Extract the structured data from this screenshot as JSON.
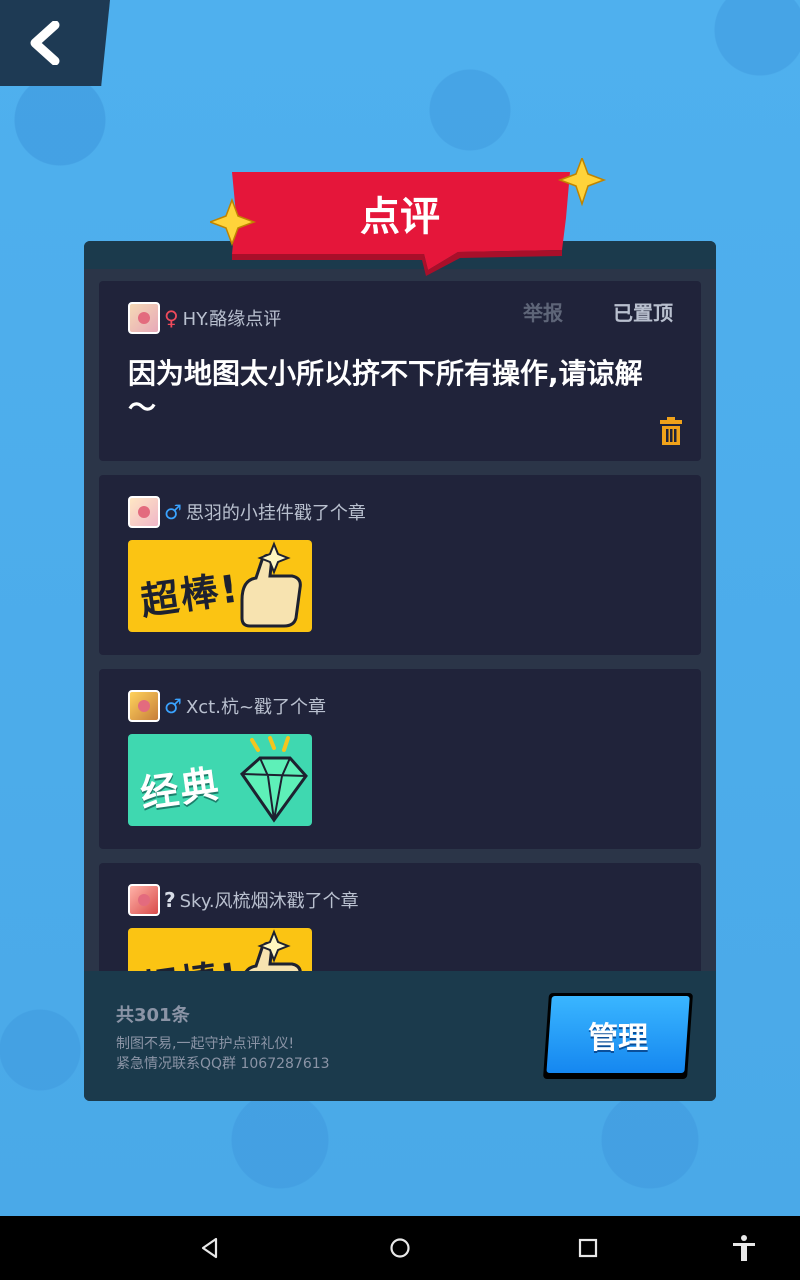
{
  "header": {
    "title": "点评"
  },
  "comments": [
    {
      "username": "HY.酪缘点评",
      "gender": "♀",
      "report_label": "举报",
      "pinned_label": "已置顶",
      "text": "因为地图太小所以挤不下所有操作,请谅解～"
    },
    {
      "username": "思羽的小挂件戳了个章",
      "gender": "♂",
      "stamp": "超棒!"
    },
    {
      "username": "Xct.杭~戳了个章",
      "gender": "♂",
      "stamp": "经典"
    },
    {
      "username": "Sky.风梳烟沐戳了个章",
      "gender": "?",
      "stamp": "超棒!"
    }
  ],
  "footer": {
    "total": "共301条",
    "note1": "制图不易,一起守护点评礼仪!",
    "note2": "紧急情况联系QQ群 1067287613",
    "manage_label": "管理"
  },
  "colors": {
    "background": "#45aaea",
    "banner": "#e5163a",
    "stamp_gold": "#fbc413",
    "stamp_green": "#3fd8b0",
    "manage_button": "#1587f0"
  },
  "icons": [
    "back-arrow-icon",
    "sparkle-icon",
    "trash-icon",
    "thumbs-up-icon",
    "diamond-icon",
    "nav-back-icon",
    "nav-home-icon",
    "nav-recents-icon",
    "accessibility-icon"
  ]
}
